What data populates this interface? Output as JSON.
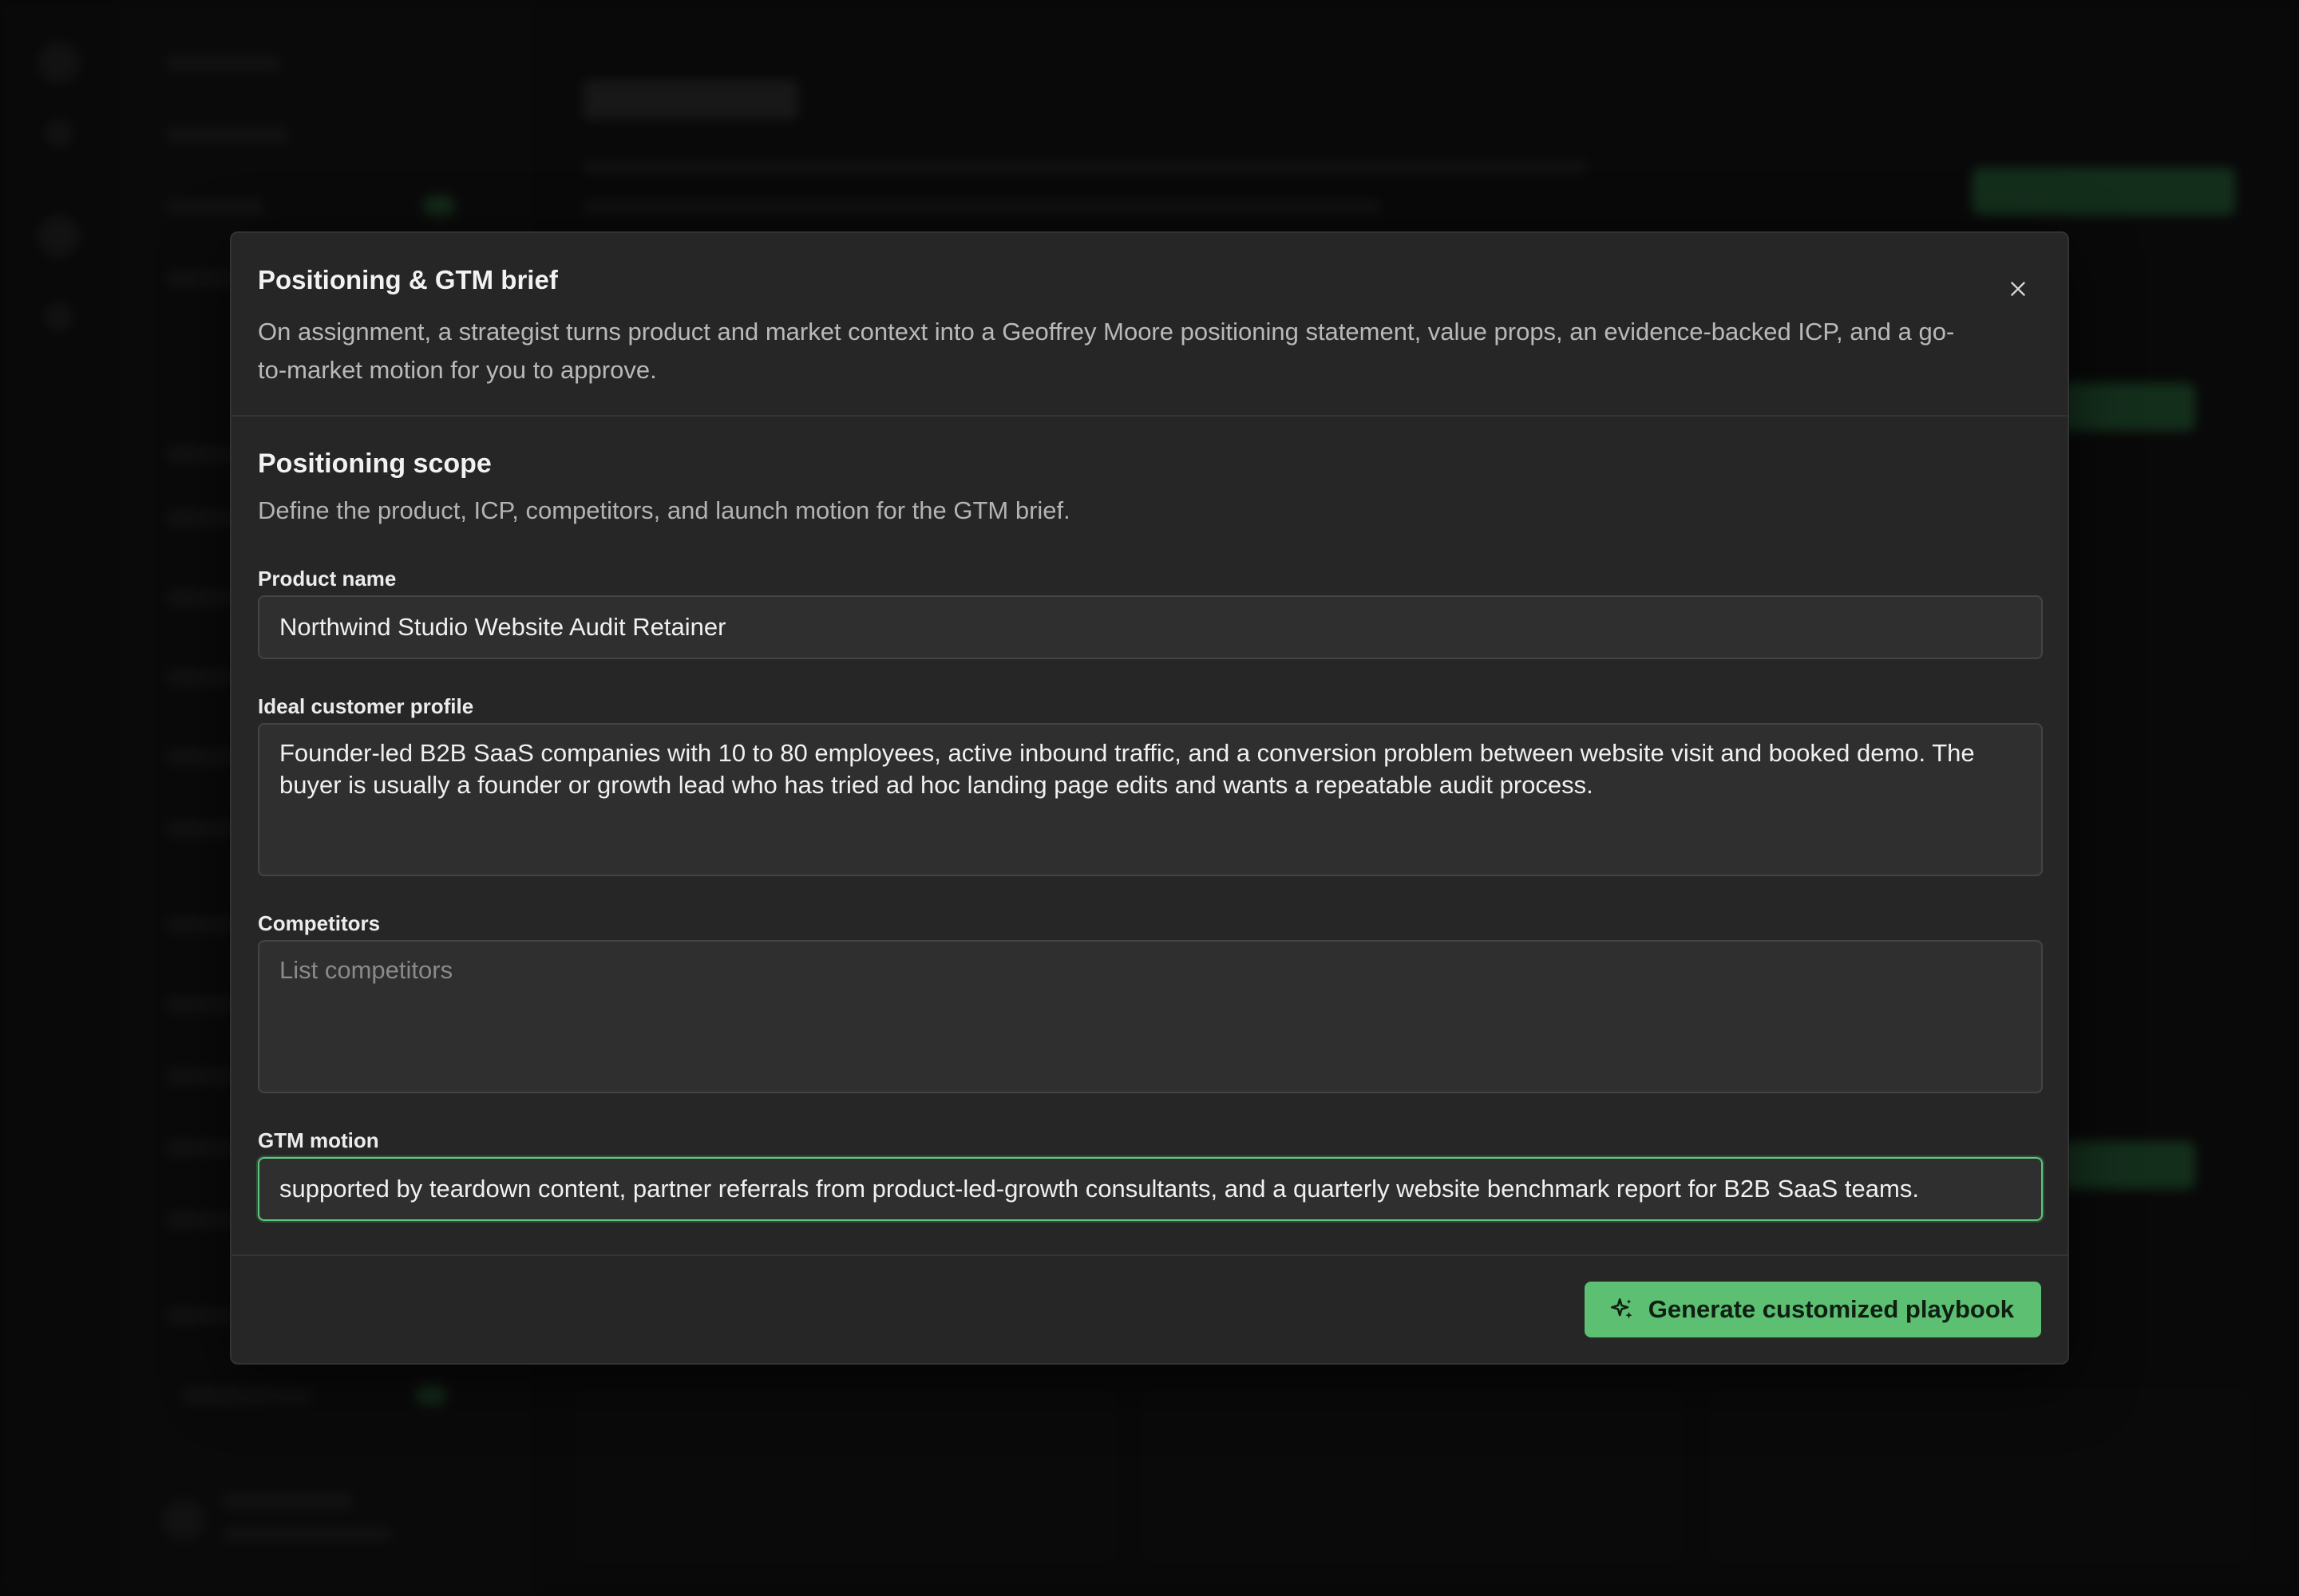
{
  "modal": {
    "title": "Positioning & GTM brief",
    "description": "On assignment, a strategist turns product and market context into a Geoffrey Moore positioning statement, value props, an evidence-backed ICP, and a go-to-market motion for you to approve.",
    "close_icon": "close-icon"
  },
  "section": {
    "title": "Positioning scope",
    "description": "Define the product, ICP, competitors, and launch motion for the GTM brief."
  },
  "fields": {
    "product_name": {
      "label": "Product name",
      "value": "Northwind Studio Website Audit Retainer"
    },
    "icp": {
      "label": "Ideal customer profile",
      "value": "Founder-led B2B SaaS companies with 10 to 80 employees, active inbound traffic, and a conversion problem between website visit and booked demo. The buyer is usually a founder or growth lead who has tried ad hoc landing page edits and wants a repeatable audit process."
    },
    "competitors": {
      "label": "Competitors",
      "value": "",
      "placeholder": "List competitors"
    },
    "gtm_motion": {
      "label": "GTM motion",
      "value": "supported by teardown content, partner referrals from product-led-growth consultants, and a quarterly website benchmark report for B2B SaaS teams."
    }
  },
  "footer": {
    "primary_button": "Generate customized playbook",
    "primary_icon": "sparkles-icon"
  },
  "colors": {
    "accent": "#5cbf72",
    "focus_ring": "#5cc77a",
    "modal_bg": "#262626",
    "field_bg": "#2f2f2f"
  }
}
